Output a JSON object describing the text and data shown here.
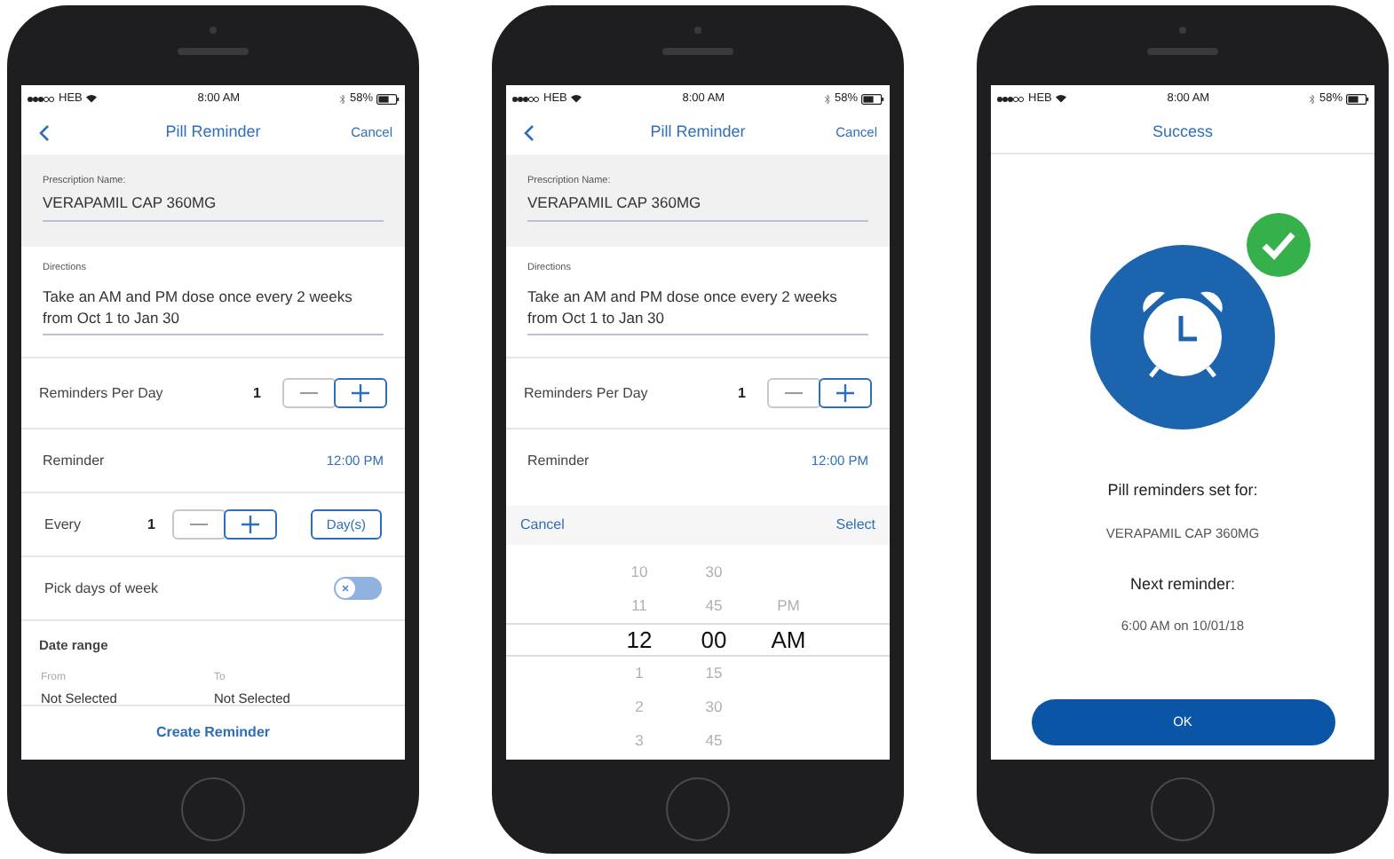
{
  "phones": [
    {
      "kind": "form",
      "status": {
        "carrier": "HEB",
        "time": "8:00 AM",
        "battery": "58%"
      },
      "nav": {
        "title": "Pill Reminder",
        "action": "Cancel"
      },
      "prescription": {
        "label": "Prescription Name:",
        "value": "VERAPAMIL CAP 360MG"
      },
      "directions": {
        "label": "Directions",
        "value": "Take an AM and PM dose once every 2 weeks from Oct 1 to Jan 30"
      },
      "rows": [
        {
          "kind": "stepper",
          "label": "Reminders Per Day",
          "value": "1"
        },
        {
          "kind": "time",
          "label": "Reminder",
          "value": "12:00 PM"
        },
        {
          "kind": "every",
          "label": "Every",
          "value": "1",
          "unit": "Day(s)"
        },
        {
          "kind": "toggle",
          "label": "Pick days of week",
          "on": false
        },
        {
          "kind": "range",
          "label": "Date range",
          "from_label": "From",
          "from_value": "Not Selected",
          "to_label": "To",
          "to_value": "Not Selected"
        }
      ],
      "footer_button": "Create Reminder"
    },
    {
      "kind": "picker",
      "status": {
        "carrier": "HEB",
        "time": "8:00 AM",
        "battery": "58%"
      },
      "nav": {
        "title": "Pill Reminder",
        "action": "Cancel"
      },
      "prescription": {
        "label": "Prescription Name:",
        "value": "VERAPAMIL CAP 360MG"
      },
      "directions": {
        "label": "Directions",
        "value": "Take an AM and PM dose once every 2 weeks from Oct 1 to Jan 30"
      },
      "rows": [
        {
          "kind": "stepper",
          "label": "Reminders Per Day",
          "value": "1"
        },
        {
          "kind": "time",
          "label": "Reminder",
          "value": "12:00 PM"
        }
      ],
      "picker": {
        "cancel": "Cancel",
        "select": "Select",
        "columns": [
          [
            {
              "text": "10",
              "selected": false
            },
            {
              "text": "11",
              "selected": false
            },
            {
              "text": "12",
              "selected": true
            },
            {
              "text": "1",
              "selected": false
            },
            {
              "text": "2",
              "selected": false
            },
            {
              "text": "3",
              "selected": false
            }
          ],
          [
            {
              "text": "30",
              "selected": false
            },
            {
              "text": "45",
              "selected": false
            },
            {
              "text": "00",
              "selected": true
            },
            {
              "text": "15",
              "selected": false
            },
            {
              "text": "30",
              "selected": false
            },
            {
              "text": "45",
              "selected": false
            }
          ],
          [
            {
              "text": "PM",
              "selected": false
            },
            {
              "text": "AM",
              "selected": true
            }
          ]
        ]
      }
    },
    {
      "kind": "success",
      "status": {
        "carrier": "HEB",
        "time": "8:00 AM",
        "battery": "58%"
      },
      "nav": {
        "title": "Success"
      },
      "heading": "Pill reminders set for:",
      "medication": "VERAPAMIL CAP 360MG",
      "next_heading": "Next reminder:",
      "next_time": "6:00 AM on 10/01/18",
      "button": "OK"
    }
  ]
}
